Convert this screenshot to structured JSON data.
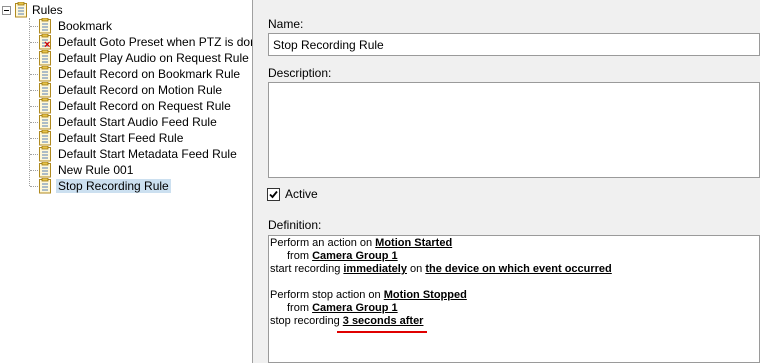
{
  "tree": {
    "root_label": "Rules",
    "items": [
      {
        "label": "Bookmark",
        "error": false,
        "selected": false
      },
      {
        "label": "Default Goto Preset when PTZ is don",
        "error": true,
        "selected": false
      },
      {
        "label": "Default Play Audio on Request Rule",
        "error": false,
        "selected": false
      },
      {
        "label": "Default Record on Bookmark Rule",
        "error": false,
        "selected": false
      },
      {
        "label": "Default Record on Motion Rule",
        "error": false,
        "selected": false
      },
      {
        "label": "Default Record on Request Rule",
        "error": false,
        "selected": false
      },
      {
        "label": "Default Start Audio Feed Rule",
        "error": false,
        "selected": false
      },
      {
        "label": "Default Start Feed Rule",
        "error": false,
        "selected": false
      },
      {
        "label": "Default Start Metadata Feed Rule",
        "error": false,
        "selected": false
      },
      {
        "label": "New Rule 001",
        "error": false,
        "selected": false
      },
      {
        "label": "Stop Recording Rule",
        "error": false,
        "selected": true
      }
    ]
  },
  "form": {
    "name_label": "Name:",
    "name_value": "Stop Recording Rule",
    "description_label": "Description:",
    "description_value": "",
    "active_label": "Active",
    "active_checked": true,
    "definition_label": "Definition:"
  },
  "definition": {
    "l1_text": "Perform an action on ",
    "l1_link": "Motion Started",
    "l2_text": "from ",
    "l2_link": "Camera Group 1",
    "l3_text": "start recording ",
    "l3_link1": "immediately",
    "l3_mid": " on ",
    "l3_link2": "the device on which event occurred",
    "l4_text": "Perform stop action on ",
    "l4_link": "Motion Stopped",
    "l5_text": "from ",
    "l5_link": "Camera Group 1",
    "l6_text": "stop recording ",
    "l6_link": "3 seconds after"
  },
  "colors": {
    "selection": "#cce0f0",
    "error_mark": "#d40000",
    "highlight_underline": "#e00000"
  }
}
